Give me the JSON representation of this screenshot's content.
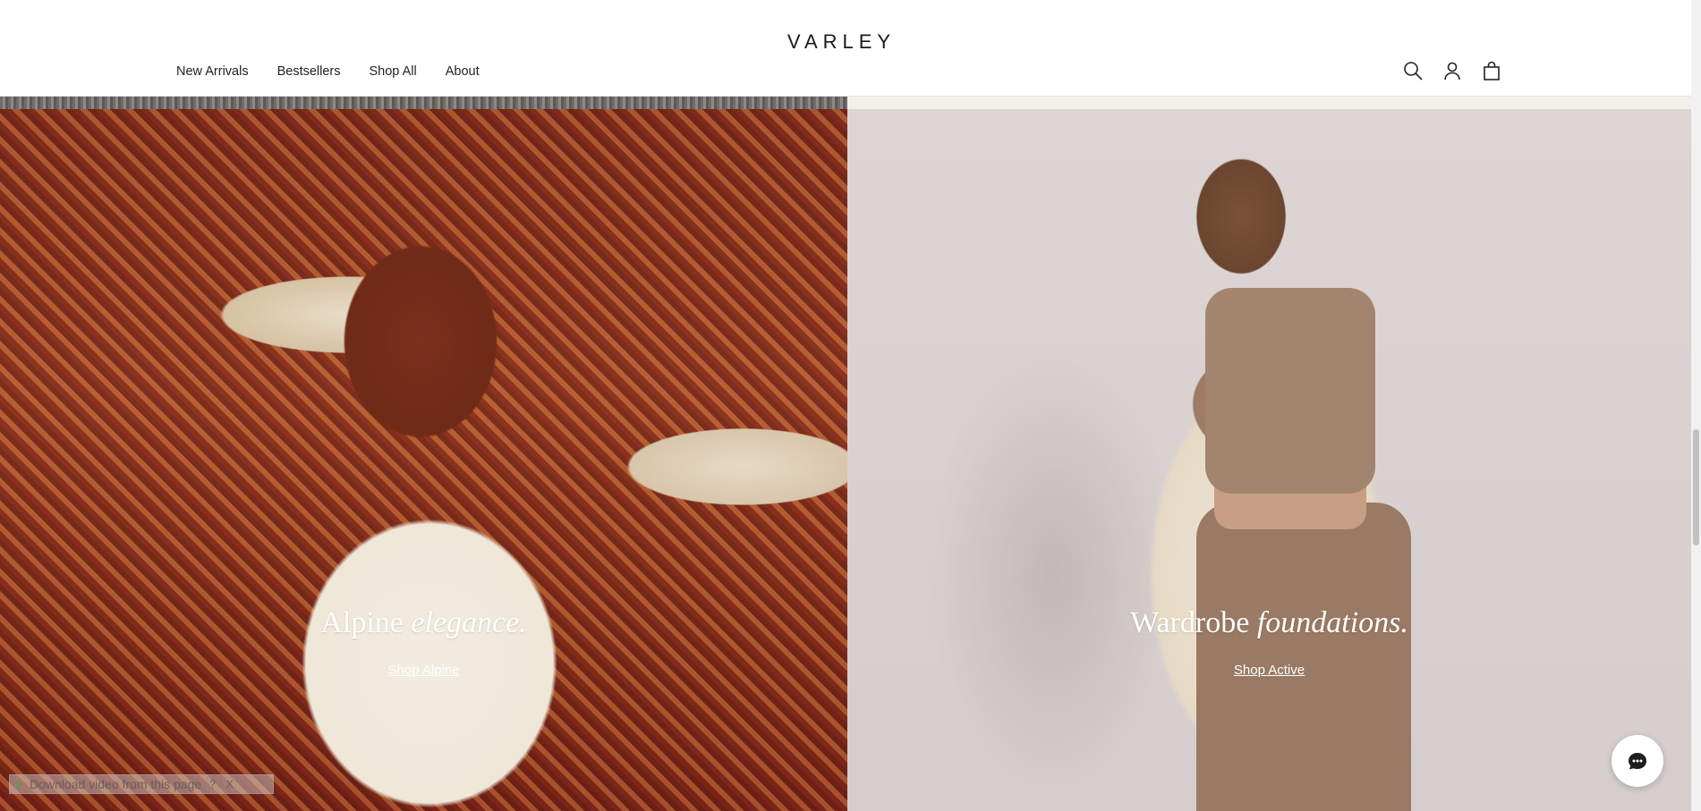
{
  "header": {
    "logo": "VARLEY",
    "nav": [
      "New Arrivals",
      "Bestsellers",
      "Shop All",
      "About"
    ],
    "icons": [
      "search-icon",
      "account-icon",
      "bag-icon"
    ]
  },
  "panels": {
    "left": {
      "title_plain": "Alpine ",
      "title_italic": "elegance.",
      "link": "Shop Alpine"
    },
    "right": {
      "title_plain": "Wardrobe ",
      "title_italic": "foundations.",
      "link": "Shop Active"
    }
  },
  "chat": {
    "icon": "chat-icon"
  },
  "download_bar": {
    "text": "Download video from this page",
    "help": "?",
    "close": "X"
  }
}
